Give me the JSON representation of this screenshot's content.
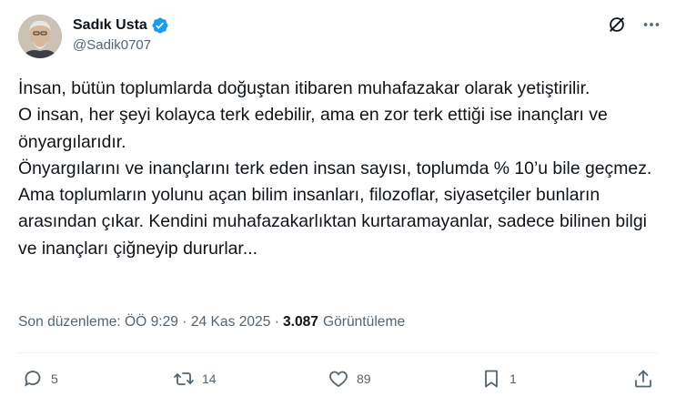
{
  "author": {
    "display_name": "Sadık Usta",
    "handle": "@Sadik0707",
    "verified": true
  },
  "tweet": {
    "text": "İnsan, bütün toplumlarda doğuştan itibaren muhafazakar olarak yetiştirilir.\nO insan, her şeyi kolayca terk edebilir, ama en zor terk ettiği ise inançları ve önyargılarıdır.\nÖnyargılarını ve inançlarını terk eden insan sayısı, toplumda % 10’u bile geçmez. Ama toplumların yolunu açan bilim insanları, filozoflar, siyasetçiler bunların arasından çıkar. Kendini muhafazakarlıktan kurtaramayanlar, sadece bilinen bilgi ve inançları çiğneyip dururlar..."
  },
  "meta": {
    "edited": "Son düzenleme: ÖÖ 9:29 · 24 Kas 2025 · ",
    "views_count": "3.087",
    "views_label": "Görüntüleme"
  },
  "actions": {
    "replies": "5",
    "reposts": "14",
    "likes": "89",
    "bookmarks": "1"
  },
  "colors": {
    "text": "#0f1419",
    "secondary": "#536471",
    "verified": "#1d9bf0",
    "divider": "#eff3f4"
  }
}
